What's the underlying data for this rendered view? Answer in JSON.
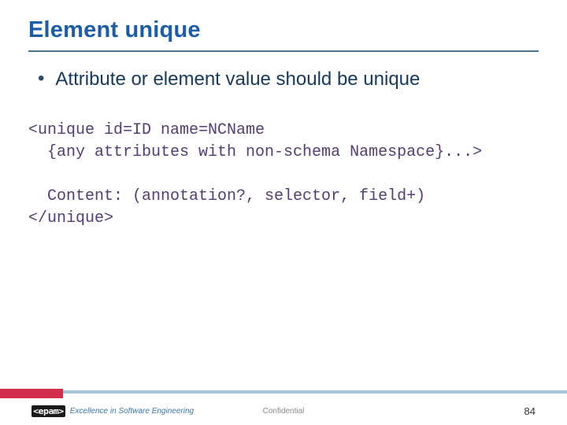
{
  "title": "Element unique",
  "bullet": "Attribute or element value should be unique",
  "code": "<unique id=ID name=NCName\n  {any attributes with non-schema Namespace}...>\n\n  Content: (annotation?, selector, field+)\n</unique>",
  "footer": {
    "logo_text": "<epam>",
    "tagline": "Excellence in Software Engineering",
    "confidential": "Confidential",
    "page": "84"
  }
}
